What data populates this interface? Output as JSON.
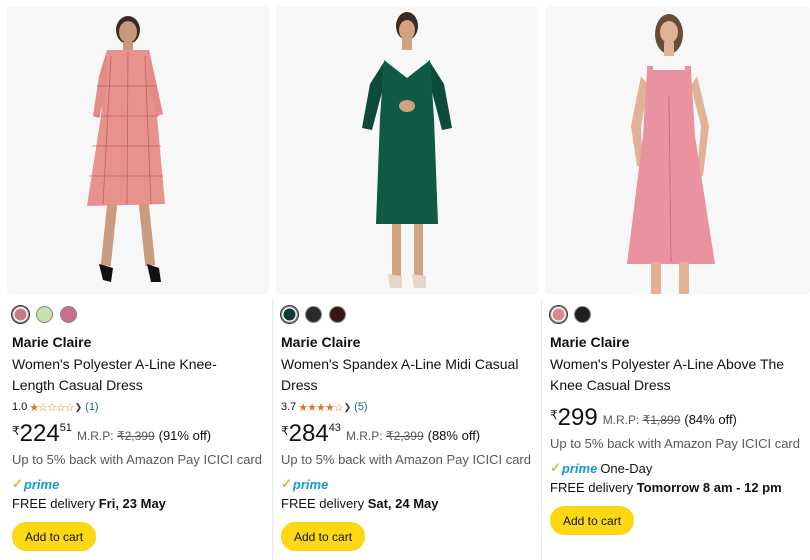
{
  "products": [
    {
      "swatches": [
        "#c77b86",
        "#c9dfb0",
        "#c86f8e"
      ],
      "selected_swatch": 0,
      "brand": "Marie Claire",
      "title": "Women's Polyester A-Line Knee-Length Casual Dress",
      "title_line1": "Women's Polyester A-Line Knee-",
      "title_line2": "Length Casual Dress",
      "rating": "1.0",
      "stars": "★☆☆☆☆",
      "rating_count": "(1)",
      "currency": "₹",
      "price_whole": "224",
      "price_fraction": "51",
      "mrp_label": "M.R.P:",
      "mrp_value": "₹2,399",
      "discount": "(91% off)",
      "cashback": "Up to 5% back with Amazon Pay ICICI card",
      "prime": true,
      "prime_text": "prime",
      "delivery_prefix": "FREE delivery",
      "delivery_date": "Fri, 23 May",
      "add_to_cart": "Add to cart"
    },
    {
      "swatches": [
        "#0e3b33",
        "#2b2b2b",
        "#3a1717"
      ],
      "selected_swatch": 0,
      "brand": "Marie Claire",
      "title_line1": "Women's Spandex A-Line Midi Casual",
      "title_line2": "Dress",
      "rating": "3.7",
      "stars": "★★★★☆",
      "rating_count": "(5)",
      "currency": "₹",
      "price_whole": "284",
      "price_fraction": "43",
      "mrp_label": "M.R.P:",
      "mrp_value": "₹2,399",
      "discount": "(88% off)",
      "cashback": "Up to 5% back with Amazon Pay ICICI card",
      "prime": true,
      "prime_text": "prime",
      "delivery_prefix": "FREE delivery",
      "delivery_date": "Sat, 24 May",
      "add_to_cart": "Add to cart"
    },
    {
      "swatches": [
        "#d98a8f",
        "#1f1f1f"
      ],
      "selected_swatch": 0,
      "brand": "Marie Claire",
      "title_line1": "Women's Polyester A-Line Above The",
      "title_line2": "Knee Casual Dress",
      "currency": "₹",
      "price_whole": "299",
      "mrp_label": "M.R.P:",
      "mrp_value": "₹1,899",
      "discount": "(84% off)",
      "cashback": "Up to 5% back with Amazon Pay ICICI card",
      "prime": true,
      "prime_text": "prime",
      "prime_speed": "One-Day",
      "delivery_prefix": "FREE delivery",
      "delivery_date": "Tomorrow 8 am - 12 pm",
      "add_to_cart": "Add to cart"
    }
  ],
  "icons": {
    "star": "star-icon",
    "chevron": "chevron-down-icon",
    "prime_check": "prime-check-icon"
  },
  "colors": {
    "button": "#ffd814",
    "link": "#2162a1",
    "star": "#de7921",
    "prime": "#1399d5"
  }
}
